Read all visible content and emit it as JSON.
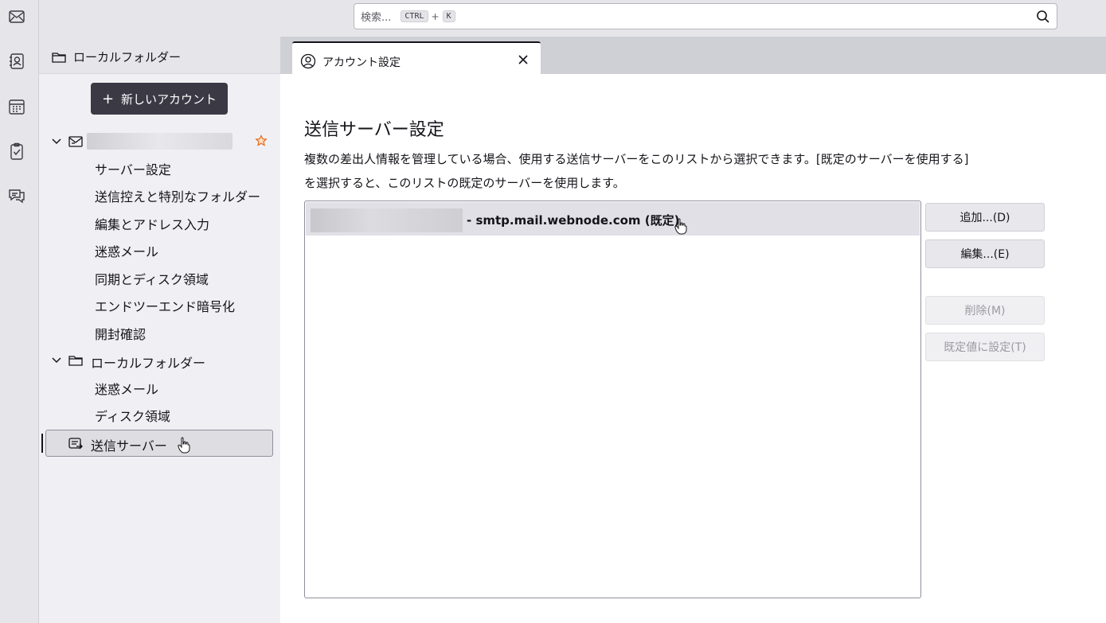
{
  "search": {
    "placeholder": "検索...",
    "key1": "CTRL",
    "plus": "+",
    "key2": "K"
  },
  "spaces": [
    "mail-icon",
    "address-book-icon",
    "calendar-icon",
    "tasks-icon",
    "chat-icon"
  ],
  "folder_pane": {
    "header": "ローカルフォルダー"
  },
  "sidebar": {
    "new_account_plus": "+",
    "new_account_label": "新しいアカウント",
    "account_items": [
      "サーバー設定",
      "送信控えと特別なフォルダー",
      "編集とアドレス入力",
      "迷惑メール",
      "同期とディスク領域",
      "エンドツーエンド暗号化",
      "開封確認"
    ],
    "local_folders_label": "ローカルフォルダー",
    "local_items": [
      "迷惑メール",
      "ディスク領域"
    ],
    "outgoing_server_label": "送信サーバー"
  },
  "tab": {
    "label": "アカウント設定"
  },
  "main": {
    "title": "送信サーバー設定",
    "description_line1": "複数の差出人情報を管理している場合、使用する送信サーバーをこのリストから選択できます。[既定のサーバーを使用する]",
    "description_line2": "を選択すると、このリストの既定のサーバーを使用します。",
    "server_entry": "- smtp.mail.webnode.com (既定)",
    "buttons": {
      "add": "追加...(D)",
      "edit": "編集...(E)",
      "delete": "削除(M)",
      "set_default": "既定値に設定(T)"
    }
  },
  "colors": {
    "accent_dark": "#3a3944",
    "star": "#e66a1a",
    "selected_row": "#e0e0e6"
  }
}
